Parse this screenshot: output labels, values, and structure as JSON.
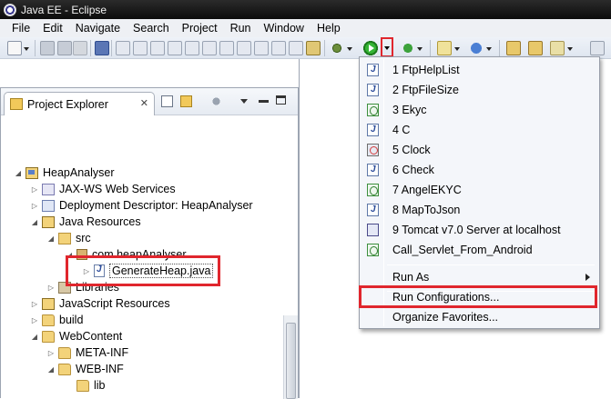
{
  "window": {
    "title": "Java EE - Eclipse"
  },
  "menubar": [
    "File",
    "Edit",
    "Navigate",
    "Search",
    "Project",
    "Run",
    "Window",
    "Help"
  ],
  "project_explorer": {
    "tab_label": "Project Explorer",
    "tree": [
      {
        "label": "HeapAnalyser",
        "icon": "project-icon",
        "level": 0,
        "twisty": "expanded"
      },
      {
        "label": "JAX-WS Web Services",
        "icon": "web-services-icon",
        "level": 1,
        "twisty": "collapsed"
      },
      {
        "label": "Deployment Descriptor: HeapAnalyser",
        "icon": "deployment-descriptor-icon",
        "level": 1,
        "twisty": "collapsed"
      },
      {
        "label": "Java Resources",
        "icon": "java-resources-icon",
        "level": 1,
        "twisty": "expanded"
      },
      {
        "label": "src",
        "icon": "source-folder-icon",
        "level": 2,
        "twisty": "expanded"
      },
      {
        "label": "com.heapAnalyser",
        "icon": "package-icon",
        "level": 3,
        "twisty": "expanded"
      },
      {
        "label": "GenerateHeap.java",
        "icon": "java-file-icon",
        "level": 4,
        "twisty": "collapsed"
      },
      {
        "label": "Libraries",
        "icon": "libraries-icon",
        "level": 2,
        "twisty": "collapsed"
      },
      {
        "label": "JavaScript Resources",
        "icon": "javascript-resources-icon",
        "level": 1,
        "twisty": "collapsed"
      },
      {
        "label": "build",
        "icon": "folder-icon",
        "level": 1,
        "twisty": "collapsed"
      },
      {
        "label": "WebContent",
        "icon": "folder-icon",
        "level": 1,
        "twisty": "expanded"
      },
      {
        "label": "META-INF",
        "icon": "folder-icon",
        "level": 2,
        "twisty": "collapsed"
      },
      {
        "label": "WEB-INF",
        "icon": "folder-icon",
        "level": 2,
        "twisty": "expanded"
      },
      {
        "label": "lib",
        "icon": "folder-icon",
        "level": 3,
        "twisty": "none"
      }
    ]
  },
  "run_menu": {
    "history": [
      {
        "label": "1 FtpHelpList",
        "icon": "java-app-icon"
      },
      {
        "label": "2 FtpFileSize",
        "icon": "java-app-icon"
      },
      {
        "label": "3 Ekyc",
        "icon": "android-app-icon"
      },
      {
        "label": "4 C",
        "icon": "java-app-icon"
      },
      {
        "label": "5 Clock",
        "icon": "clock-app-icon"
      },
      {
        "label": "6 Check",
        "icon": "java-app-icon"
      },
      {
        "label": "7 AngelEKYC",
        "icon": "android-app-icon"
      },
      {
        "label": "8 MapToJson",
        "icon": "java-app-icon"
      },
      {
        "label": "9 Tomcat v7.0 Server at localhost",
        "icon": "tomcat-server-icon"
      },
      {
        "label": "Call_Servlet_From_Android",
        "icon": "android-app-icon"
      }
    ],
    "run_as": "Run As",
    "run_configurations": "Run Configurations...",
    "organize_favorites": "Organize Favorites..."
  }
}
